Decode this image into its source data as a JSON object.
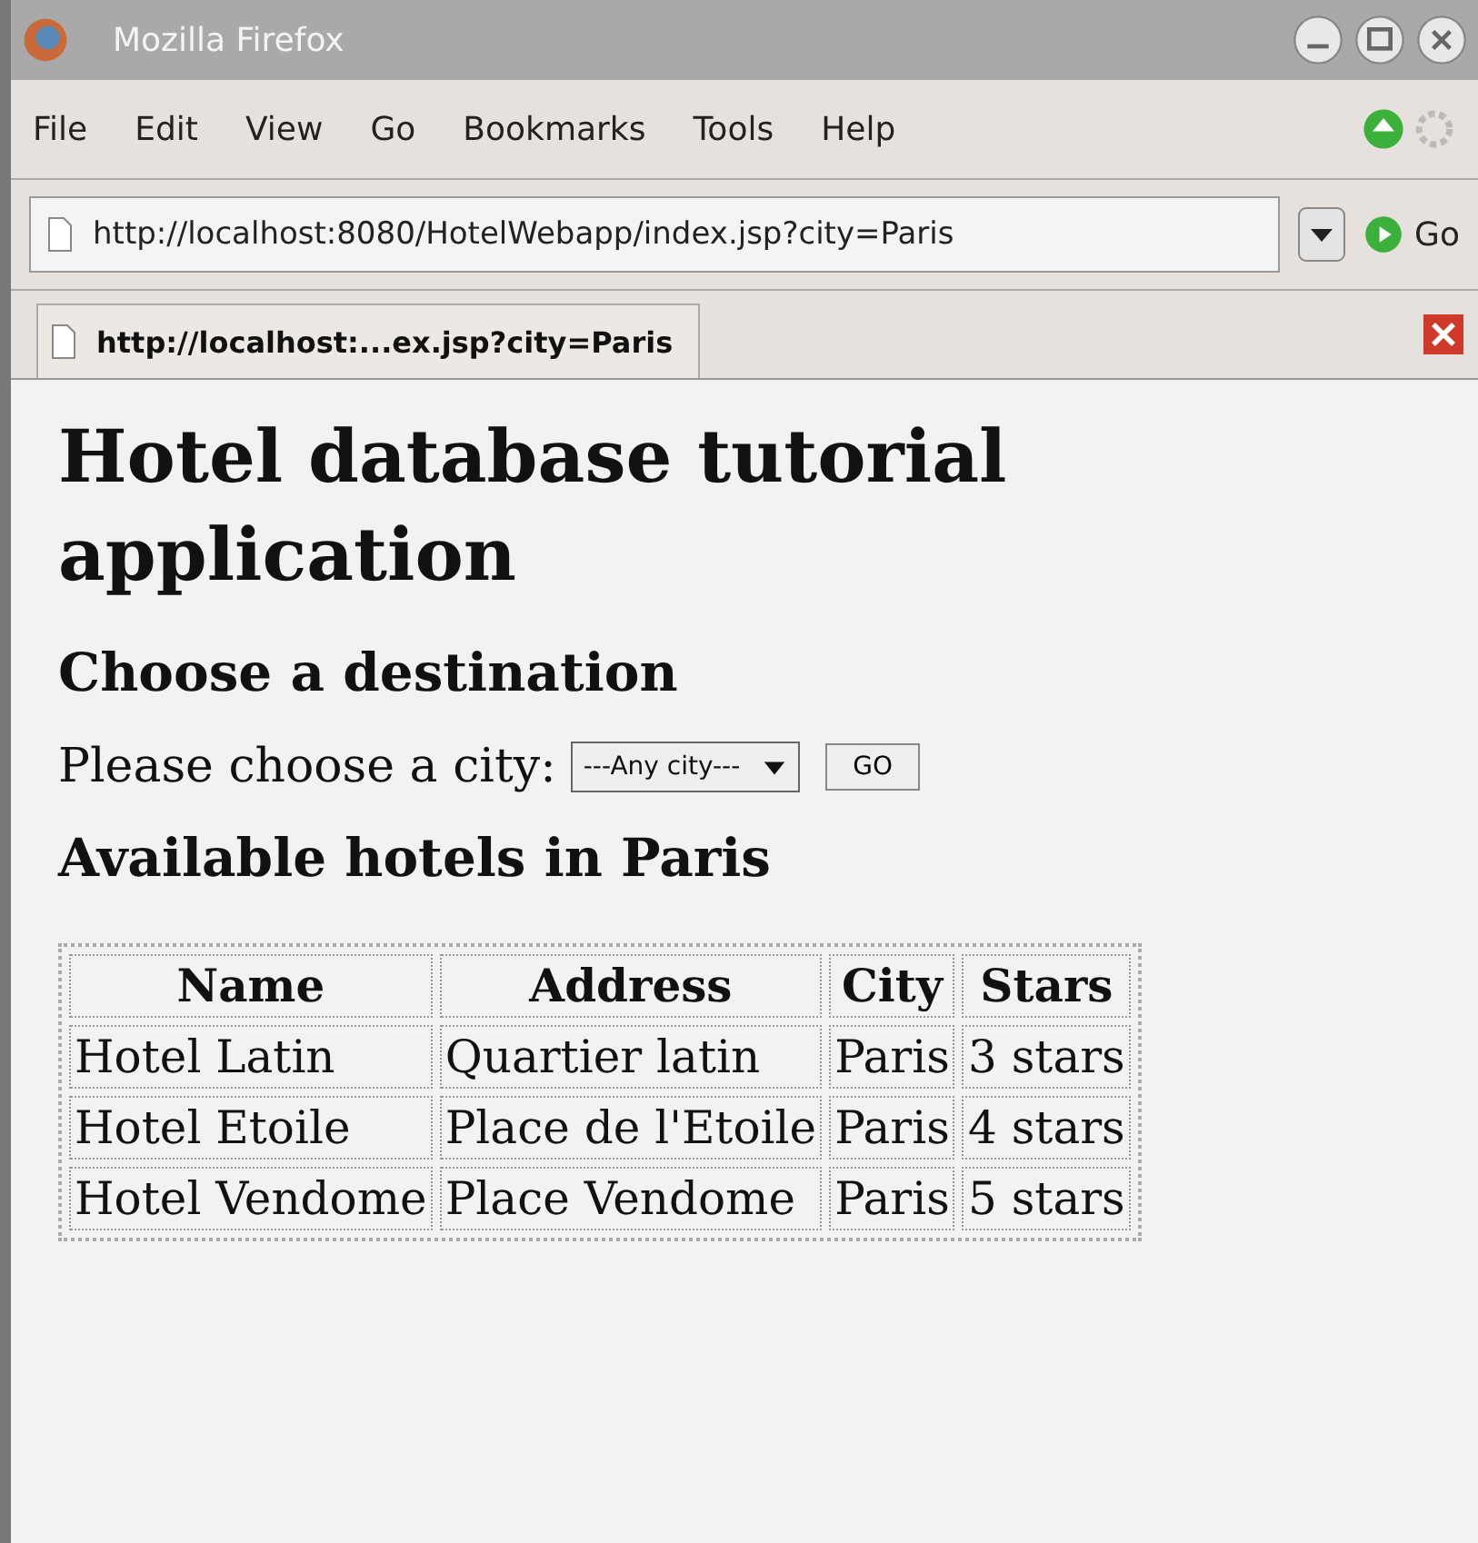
{
  "window": {
    "title": "Mozilla Firefox"
  },
  "menu": [
    "File",
    "Edit",
    "View",
    "Go",
    "Bookmarks",
    "Tools",
    "Help"
  ],
  "address_bar": {
    "value": "http://localhost:8080/HotelWebapp/index.jsp?city=Paris",
    "go_label": "Go"
  },
  "tabs": [
    {
      "label": "http://localhost:...ex.jsp?city=Paris",
      "selected": true
    }
  ],
  "page": {
    "heading": "Hotel database tutorial application",
    "subheading": "Choose a destination",
    "prompt": "Please choose a city:",
    "city_select": "---Any city---",
    "go_button": "GO",
    "results_heading": "Available hotels in Paris",
    "table": {
      "columns": [
        "Name",
        "Address",
        "City",
        "Stars"
      ],
      "rows": [
        [
          "Hotel Latin",
          "Quartier latin",
          "Paris",
          "3 stars"
        ],
        [
          "Hotel Etoile",
          "Place de l'Etoile",
          "Paris",
          "4 stars"
        ],
        [
          "Hotel Vendome",
          "Place Vendome",
          "Paris",
          "5 stars"
        ]
      ]
    }
  }
}
